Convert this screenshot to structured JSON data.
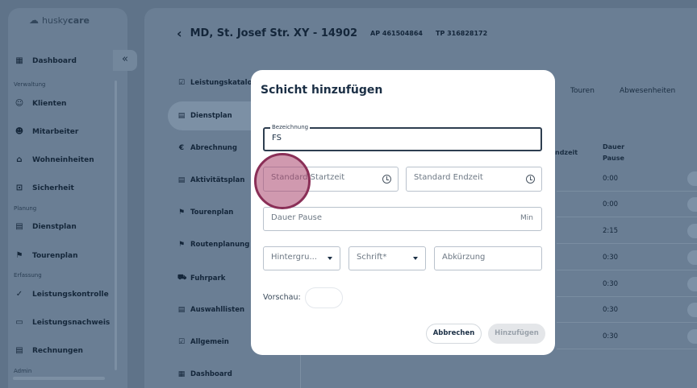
{
  "app": {
    "logo_text_light": "husky",
    "logo_text_bold": "care"
  },
  "sidebar": {
    "sections": [
      {
        "label": "Verwaltung"
      },
      {
        "label": "Planung"
      },
      {
        "label": "Erfassung"
      },
      {
        "label": "Admin"
      }
    ],
    "items": [
      {
        "label": "Dashboard",
        "icon": "dashboard-icon"
      },
      {
        "label": "Klienten",
        "icon": "clients-icon"
      },
      {
        "label": "Mitarbeiter",
        "icon": "employee-icon"
      },
      {
        "label": "Wohneinheiten",
        "icon": "housing-icon"
      },
      {
        "label": "Sicherheit",
        "icon": "lock-icon"
      },
      {
        "label": "Dienstplan",
        "icon": "calendar-icon"
      },
      {
        "label": "Tourenplan",
        "icon": "flag-icon"
      },
      {
        "label": "Leistungskontrolle",
        "icon": "check-circle-icon"
      },
      {
        "label": "Leistungsnachweis",
        "icon": "document-icon"
      },
      {
        "label": "Rechnungen",
        "icon": "invoice-icon"
      }
    ],
    "collapse_icon": "«"
  },
  "header": {
    "title": "MD, St. Josef Str. XY - 14902",
    "ap": "AP 461504864",
    "tp": "TP 316828172"
  },
  "subnav": {
    "items": [
      {
        "label": "Leistungskatalog",
        "icon": "list-check-icon"
      },
      {
        "label": "Dienstplan",
        "icon": "calendar-icon"
      },
      {
        "label": "Abrechnung",
        "icon": "euro-icon"
      },
      {
        "label": "Aktivitätsplan",
        "icon": "calendar-icon"
      },
      {
        "label": "Tourenplan",
        "icon": "flag-icon"
      },
      {
        "label": "Routenplanung",
        "icon": "flag-icon"
      },
      {
        "label": "Fuhrpark",
        "icon": "car-icon"
      },
      {
        "label": "Auswahllisten",
        "icon": "calendar-icon"
      },
      {
        "label": "Allgemein",
        "icon": "list-check-icon"
      },
      {
        "label": "Dashboard",
        "icon": "dashboard-icon"
      }
    ]
  },
  "tabs_right": [
    "Touren",
    "Abwesenheiten"
  ],
  "table": {
    "col_endzeit": "ndzeit",
    "col_dauer": "Dauer",
    "col_pause": "Pause",
    "rows": [
      "0:00",
      "0:00",
      "2:15",
      "0:30",
      "0:30",
      "0:30",
      "0:30"
    ]
  },
  "modal": {
    "title": "Schicht hinzufügen",
    "bezeichnung": {
      "label": "Bezeichnung",
      "value": "FS"
    },
    "start_placeholder": "Standard Startzeit",
    "end_placeholder": "Standard Endzeit",
    "pause_placeholder": "Dauer Pause",
    "pause_suffix": "Min",
    "background_placeholder": "Hintergru...",
    "font_placeholder": "Schrift*",
    "abbreviation_placeholder": "Abkürzung",
    "preview_label": "Vorschau:",
    "cancel_label": "Abbrechen",
    "add_label": "Hinzufügen"
  }
}
